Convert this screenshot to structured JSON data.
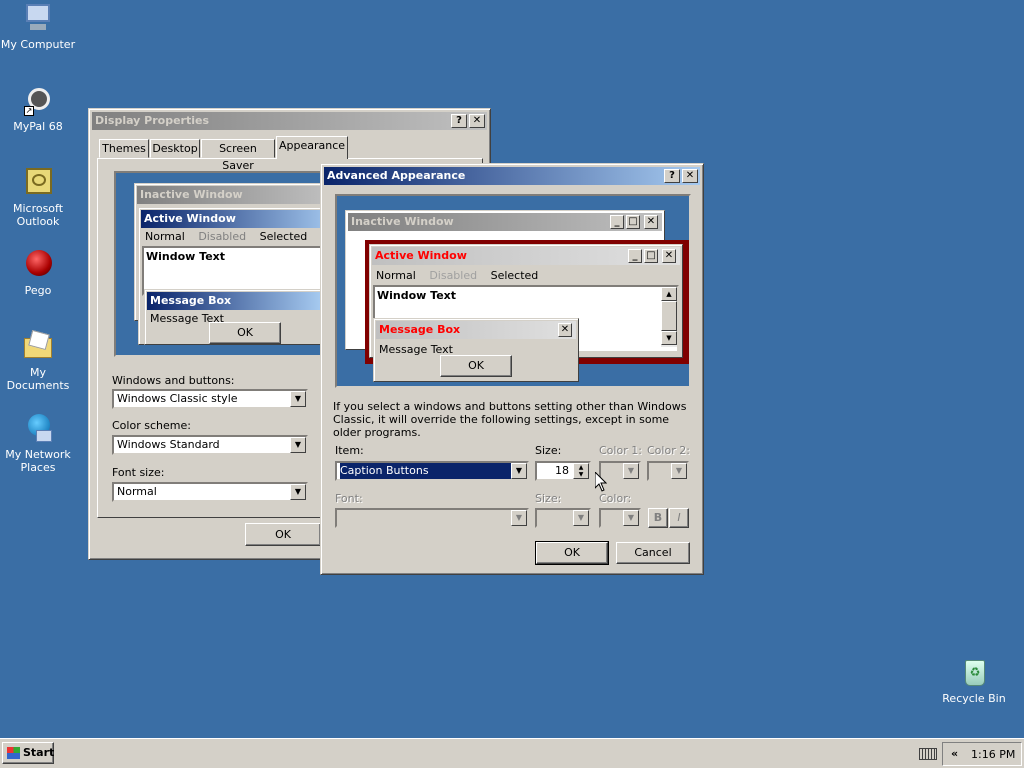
{
  "desktop": {
    "icons": [
      {
        "label": "My Computer",
        "icon": "computer-icon"
      },
      {
        "label": "MyPal 68",
        "icon": "raccoon-icon"
      },
      {
        "label": "Microsoft Outlook",
        "icon": "outlook-icon"
      },
      {
        "label": "Pego",
        "icon": "pego-icon"
      },
      {
        "label": "My Documents",
        "icon": "folder-icon"
      },
      {
        "label": "My Network Places",
        "icon": "network-icon"
      },
      {
        "label": "Recycle Bin",
        "icon": "recycle-bin-icon"
      }
    ]
  },
  "display_properties": {
    "title": "Display Properties",
    "help_btn": "?",
    "close_btn": "✕",
    "tabs": [
      "Themes",
      "Desktop",
      "Screen Saver",
      "Appearance"
    ],
    "preview": {
      "inactive_title": "Inactive Window",
      "active_title": "Active Window",
      "menu": [
        "Normal",
        "Disabled",
        "Selected"
      ],
      "window_text": "Window Text",
      "msgbox_title": "Message Box",
      "msgbox_text": "Message Text",
      "ok": "OK"
    },
    "windows_buttons_label": "Windows and buttons:",
    "windows_buttons_value": "Windows Classic style",
    "color_scheme_label": "Color scheme:",
    "color_scheme_value": "Windows Standard",
    "font_size_label": "Font size:",
    "font_size_value": "Normal",
    "ok": "OK"
  },
  "advanced_appearance": {
    "title": "Advanced Appearance",
    "help_btn": "?",
    "close_btn": "✕",
    "preview": {
      "inactive_title": "Inactive Window",
      "active_title": "Active Window",
      "menu": [
        "Normal",
        "Disabled",
        "Selected"
      ],
      "window_text": "Window Text",
      "msgbox_title": "Message Box",
      "msgbox_text": "Message Text",
      "ok": "OK"
    },
    "info_text": "If you select a windows and buttons setting other than Windows Classic, it will override the following settings, except in some older programs.",
    "item_label": "Item:",
    "item_value": "Caption Buttons",
    "size_label": "Size:",
    "size_value": "18",
    "color1_label": "Color 1:",
    "color2_label": "Color 2:",
    "font_label": "Font:",
    "font_size_label": "Size:",
    "font_color_label": "Color:",
    "bold_label": "B",
    "italic_label": "I",
    "ok": "OK",
    "cancel": "Cancel"
  },
  "taskbar": {
    "start": "Start",
    "chevron": "«",
    "clock": "1:16 PM"
  },
  "colors": {
    "desktop": "#3a6ea5",
    "active_caption": "#0a246a",
    "advanced_active_border": "#800000",
    "advanced_caption_text": "#ff0000"
  }
}
